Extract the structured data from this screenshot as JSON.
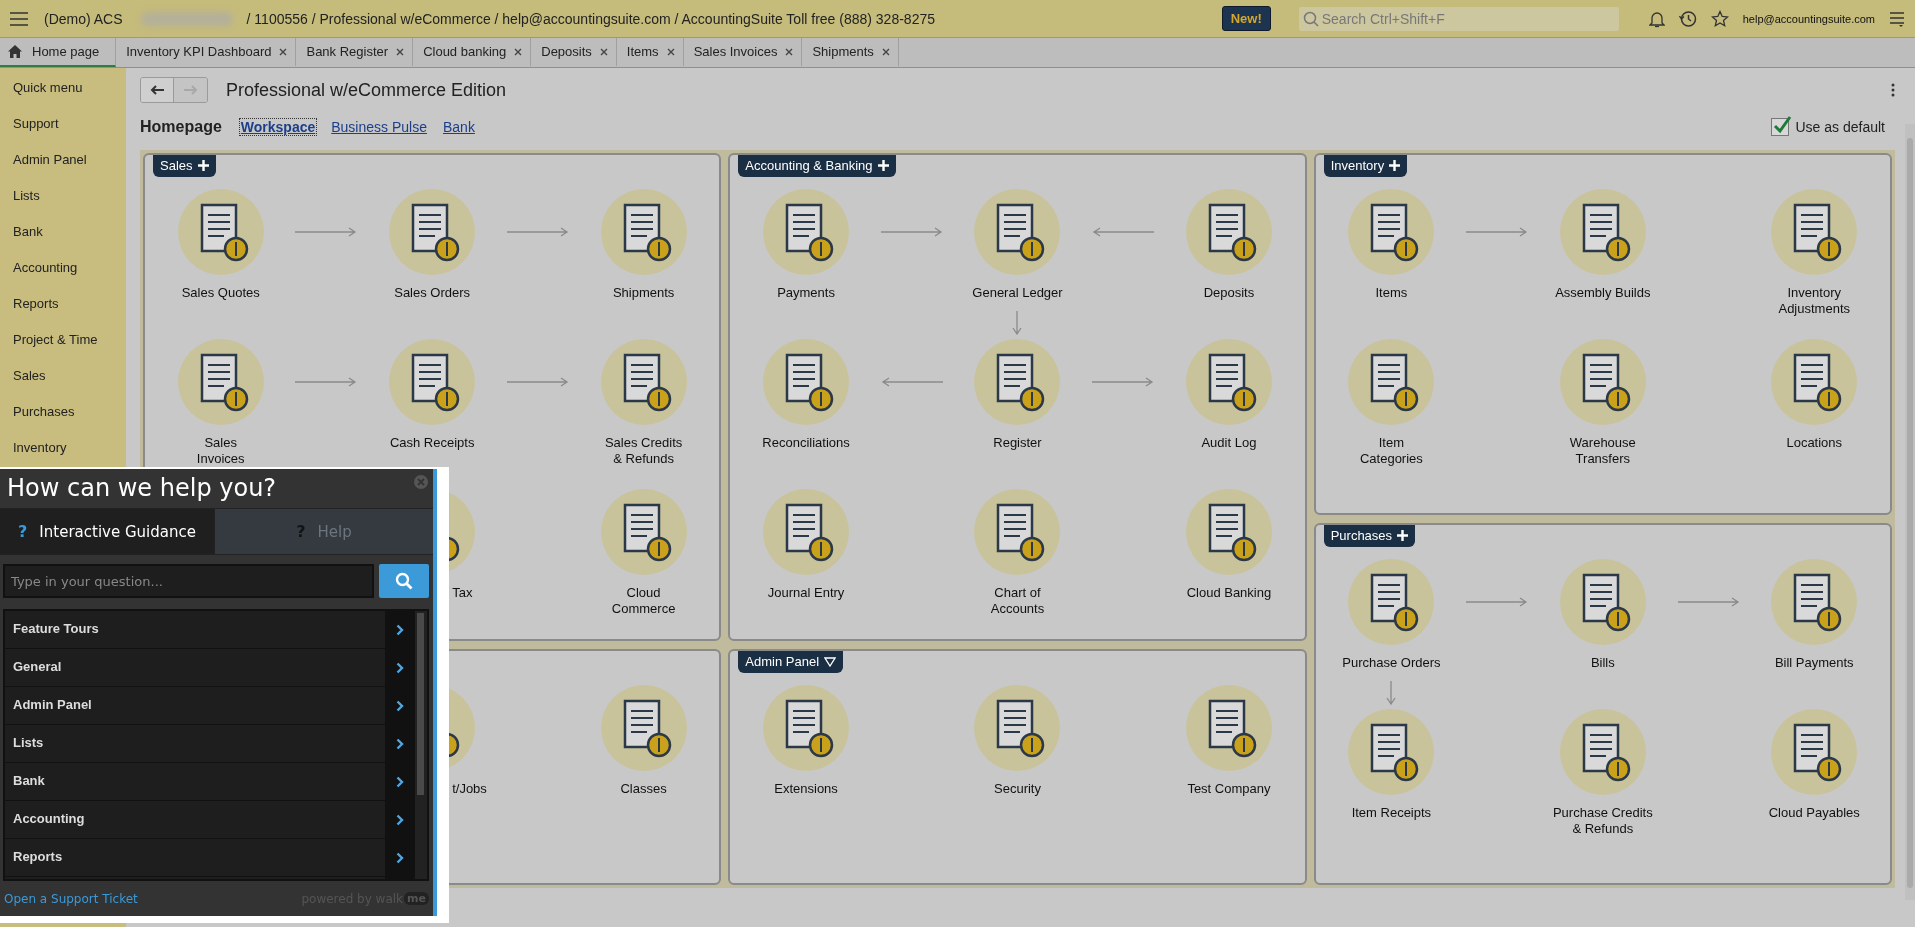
{
  "top_bar": {
    "company": "(Demo) ACS",
    "details": "/ 1100556 / Professional w/eCommerce / help@accountingsuite.com / AccountingSuite Toll free (888) 328-8275",
    "new_badge": "New!",
    "search": {
      "placeholder": "Search Ctrl+Shift+F"
    },
    "user": "help@accountingsuite.com"
  },
  "tabs": [
    {
      "label": "Home page",
      "selected": true,
      "closable": false
    },
    {
      "label": "Inventory KPI Dashboard",
      "selected": false,
      "closable": true
    },
    {
      "label": "Bank Register",
      "selected": false,
      "closable": true
    },
    {
      "label": "Cloud banking",
      "selected": false,
      "closable": true
    },
    {
      "label": "Deposits",
      "selected": false,
      "closable": true
    },
    {
      "label": "Items",
      "selected": false,
      "closable": true
    },
    {
      "label": "Sales Invoices",
      "selected": false,
      "closable": true
    },
    {
      "label": "Shipments",
      "selected": false,
      "closable": true
    }
  ],
  "sidebar": {
    "items": [
      {
        "label": "Quick menu"
      },
      {
        "label": "Support"
      },
      {
        "label": "Admin Panel"
      },
      {
        "label": "Lists"
      },
      {
        "label": "Bank"
      },
      {
        "label": "Accounting"
      },
      {
        "label": "Reports"
      },
      {
        "label": "Project & Time"
      },
      {
        "label": "Sales"
      },
      {
        "label": "Purchases"
      },
      {
        "label": "Inventory"
      }
    ]
  },
  "page": {
    "title": "Professional w/eCommerce Edition",
    "nav_buttons": [
      {
        "kind": "back",
        "disabled": false
      },
      {
        "kind": "forward",
        "disabled": true
      }
    ],
    "heading": "Homepage",
    "views": [
      {
        "label": "Workspace",
        "selected": true
      },
      {
        "label": "Business Pulse",
        "selected": false
      },
      {
        "label": "Bank",
        "selected": false
      }
    ],
    "use_as_default": {
      "label": "Use as default",
      "checked": true
    }
  },
  "workspace": {
    "columns": [
      {
        "panels": [
          {
            "title": "Sales",
            "expandable": false,
            "rows": [
              {
                "tiles": [
                  {
                    "label": "Sales Quotes",
                    "kind": "full",
                    "arrow_below": false
                  },
                  {
                    "label": "Sales Orders",
                    "kind": "full",
                    "arrow_below": false
                  },
                  {
                    "label": "Shipments",
                    "kind": "full",
                    "arrow_below": false
                  }
                ],
                "connectors": [
                  {
                    "kind": "forward"
                  },
                  {
                    "kind": "forward"
                  }
                ]
              },
              {
                "tiles": [
                  {
                    "label": "Sales\nInvoices",
                    "kind": "full",
                    "arrow_below": false
                  },
                  {
                    "label": "Cash Receipts",
                    "kind": "full",
                    "arrow_below": false
                  },
                  {
                    "label": "Sales Credits\n& Refunds",
                    "kind": "full",
                    "arrow_below": false
                  }
                ],
                "connectors": [
                  {
                    "kind": "forward"
                  },
                  {
                    "kind": "forward"
                  }
                ]
              },
              {
                "tiles": [
                  {
                    "label": "Tax",
                    "kind": "partial",
                    "arrow_below": false
                  },
                  {
                    "label": "Cloud\nCommerce",
                    "kind": "full",
                    "arrow_below": false
                  }
                ]
              }
            ]
          },
          {
            "rows": [
              {
                "tiles": [
                  {
                    "label": "t/Jobs",
                    "kind": "partial",
                    "arrow_below": false
                  },
                  {
                    "label": "Classes",
                    "kind": "full",
                    "arrow_below": false
                  }
                ]
              }
            ]
          }
        ]
      },
      {
        "panels": [
          {
            "title": "Accounting & Banking",
            "expandable": false,
            "rows": [
              {
                "tiles": [
                  {
                    "label": "Payments",
                    "kind": "full",
                    "arrow_below": false
                  },
                  {
                    "label": "General Ledger",
                    "kind": "full",
                    "arrow_below": true
                  },
                  {
                    "label": "Deposits",
                    "kind": "full",
                    "arrow_below": false
                  }
                ],
                "connectors": [
                  {
                    "kind": "forward"
                  },
                  {
                    "kind": "backward"
                  }
                ]
              },
              {
                "tiles": [
                  {
                    "label": "Reconciliations",
                    "kind": "full",
                    "arrow_below": false
                  },
                  {
                    "label": "Register",
                    "kind": "full",
                    "arrow_below": false
                  },
                  {
                    "label": "Audit Log",
                    "kind": "full",
                    "arrow_below": false
                  }
                ],
                "connectors": [
                  {
                    "kind": "backward"
                  },
                  {
                    "kind": "forward"
                  }
                ]
              },
              {
                "tiles": [
                  {
                    "label": "Journal Entry",
                    "kind": "full",
                    "arrow_below": false
                  },
                  {
                    "label": "Chart of\nAccounts",
                    "kind": "full",
                    "arrow_below": false
                  },
                  {
                    "label": "Cloud Banking",
                    "kind": "full",
                    "arrow_below": false
                  }
                ]
              }
            ]
          },
          {
            "title": "Admin Panel",
            "expandable": true,
            "rows": [
              {
                "tiles": [
                  {
                    "label": "Extensions",
                    "kind": "full",
                    "arrow_below": false
                  },
                  {
                    "label": "Security",
                    "kind": "full",
                    "arrow_below": false
                  },
                  {
                    "label": "Test Company",
                    "kind": "full",
                    "arrow_below": false
                  }
                ]
              }
            ]
          }
        ]
      },
      {
        "panels": [
          {
            "title": "Inventory",
            "expandable": false,
            "rows": [
              {
                "tiles": [
                  {
                    "label": "Items",
                    "kind": "full",
                    "arrow_below": false
                  },
                  {
                    "label": "Assembly Builds",
                    "kind": "full",
                    "arrow_below": false
                  },
                  {
                    "label": "Inventory\nAdjustments",
                    "kind": "full",
                    "arrow_below": false
                  }
                ],
                "connectors": [
                  {
                    "kind": "forward"
                  },
                  {
                    "kind": "none"
                  }
                ]
              },
              {
                "tiles": [
                  {
                    "label": "Item\nCategories",
                    "kind": "full",
                    "arrow_below": false
                  },
                  {
                    "label": "Warehouse\nTransfers",
                    "kind": "full",
                    "arrow_below": false
                  },
                  {
                    "label": "Locations",
                    "kind": "full",
                    "arrow_below": false
                  }
                ]
              }
            ]
          },
          {
            "title": "Purchases",
            "expandable": false,
            "rows": [
              {
                "tiles": [
                  {
                    "label": "Purchase Orders",
                    "kind": "full",
                    "arrow_below": true
                  },
                  {
                    "label": "Bills",
                    "kind": "full",
                    "arrow_below": false
                  },
                  {
                    "label": "Bill Payments",
                    "kind": "full",
                    "arrow_below": false
                  }
                ],
                "connectors": [
                  {
                    "kind": "forward"
                  },
                  {
                    "kind": "forward"
                  }
                ]
              },
              {
                "tiles": [
                  {
                    "label": "Item Receipts",
                    "kind": "full",
                    "arrow_below": false
                  },
                  {
                    "label": "Purchase Credits\n& Refunds",
                    "kind": "full",
                    "arrow_below": false
                  },
                  {
                    "label": "Cloud Payables",
                    "kind": "full",
                    "arrow_below": false
                  }
                ]
              }
            ]
          }
        ]
      }
    ]
  },
  "help": {
    "title": "How can we help you?",
    "tabs": [
      {
        "icon": "?",
        "label": "Interactive Guidance",
        "selected": true
      },
      {
        "icon": "?",
        "label": "Help",
        "selected": false
      }
    ],
    "search": {
      "placeholder": "Type in your question..."
    },
    "items": [
      {
        "label": "Feature Tours"
      },
      {
        "label": "General"
      },
      {
        "label": "Admin Panel"
      },
      {
        "label": "Lists"
      },
      {
        "label": "Bank"
      },
      {
        "label": "Accounting"
      },
      {
        "label": "Reports"
      }
    ],
    "support_link": "Open a Support Ticket",
    "powered_by": "powered by walk",
    "brand_badge": "me"
  }
}
